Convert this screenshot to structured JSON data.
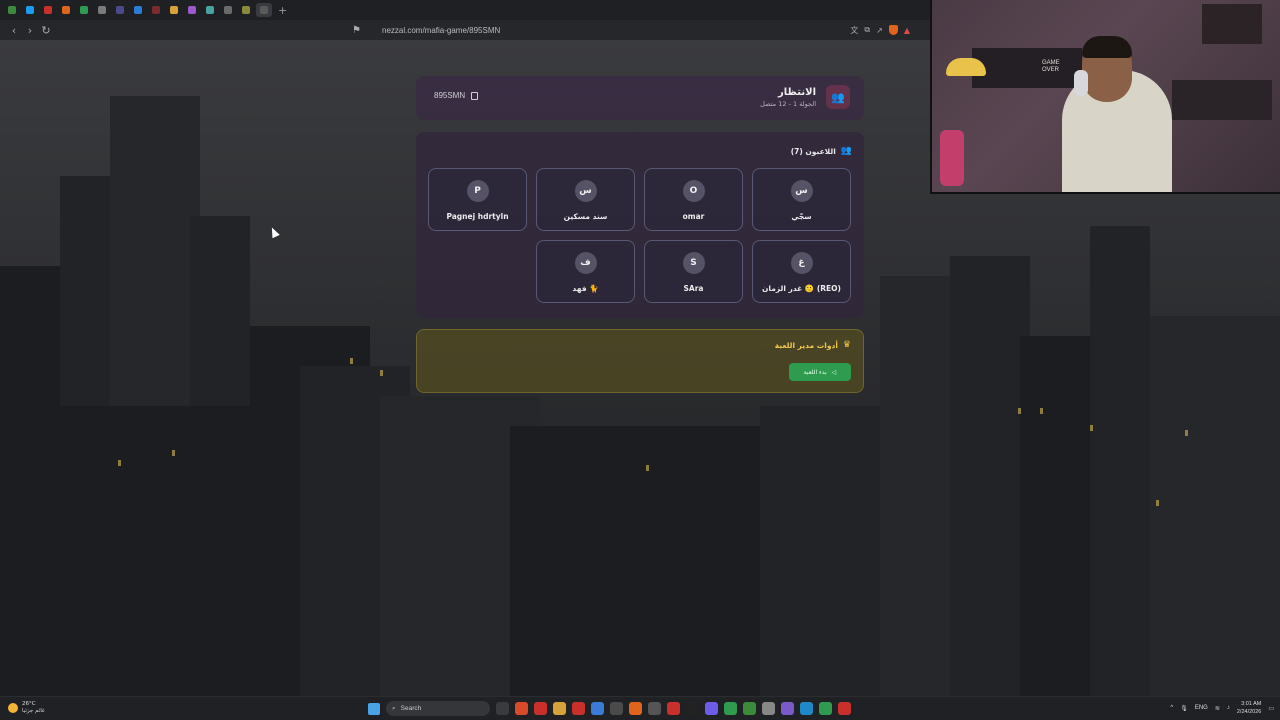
{
  "browser": {
    "url": "nezzal.com/mafia-game/895SMN",
    "tab_colors": [
      "#3a8b3c",
      "#1d9bf0",
      "#c9302c",
      "#e0641c",
      "#2e9b4f",
      "#7a7a7a",
      "#4a4a8a",
      "#2c7bd6",
      "#7a2c2c",
      "#d8a23a",
      "#9a5ac8",
      "#4aa3a3",
      "#6a6a6a",
      "#8a8a3a",
      "#5a5a5a"
    ]
  },
  "game": {
    "room_code": "895SMN",
    "header": {
      "title": "الانتظار",
      "subtitle": "الجولة 1 - 12 متصل"
    },
    "players_title": "اللاعبون (7)",
    "players": [
      {
        "initial": "س",
        "name": "سجّي"
      },
      {
        "initial": "O",
        "name": "omar"
      },
      {
        "initial": "س",
        "name": "سند مسكين"
      },
      {
        "initial": "P",
        "name": "Pagnej hdrtyln"
      },
      {
        "initial": "غ",
        "name": "غدر الزمان 🙂 (REO)"
      },
      {
        "initial": "S",
        "name": "SAra"
      },
      {
        "initial": "ف",
        "name": "فهد 🐈"
      }
    ],
    "host_tools": {
      "title": "أدوات مدير اللعبة",
      "start_button": "بدء اللعبة"
    }
  },
  "webcam": {
    "sign_text": [
      "GAME",
      "OVER"
    ]
  },
  "taskbar": {
    "weather_temp": "26°C",
    "weather_desc": "غائم جزئيا",
    "search_placeholder": "Search",
    "language": "ENG",
    "time": "3:01 AM",
    "date": "2/24/2026",
    "app_colors": [
      "#3a3b3f",
      "#d84a2a",
      "#c9302c",
      "#d8a23a",
      "#c9302c",
      "#3a7bd6",
      "#4a4a4a",
      "#e0641c",
      "#555",
      "#c9302c",
      "#222",
      "#6c5ce7",
      "#2e9b4f",
      "#3a8b3c",
      "#888",
      "#7a5ac8",
      "#1e88c9",
      "#2e9b4f",
      "#c9302c"
    ]
  }
}
